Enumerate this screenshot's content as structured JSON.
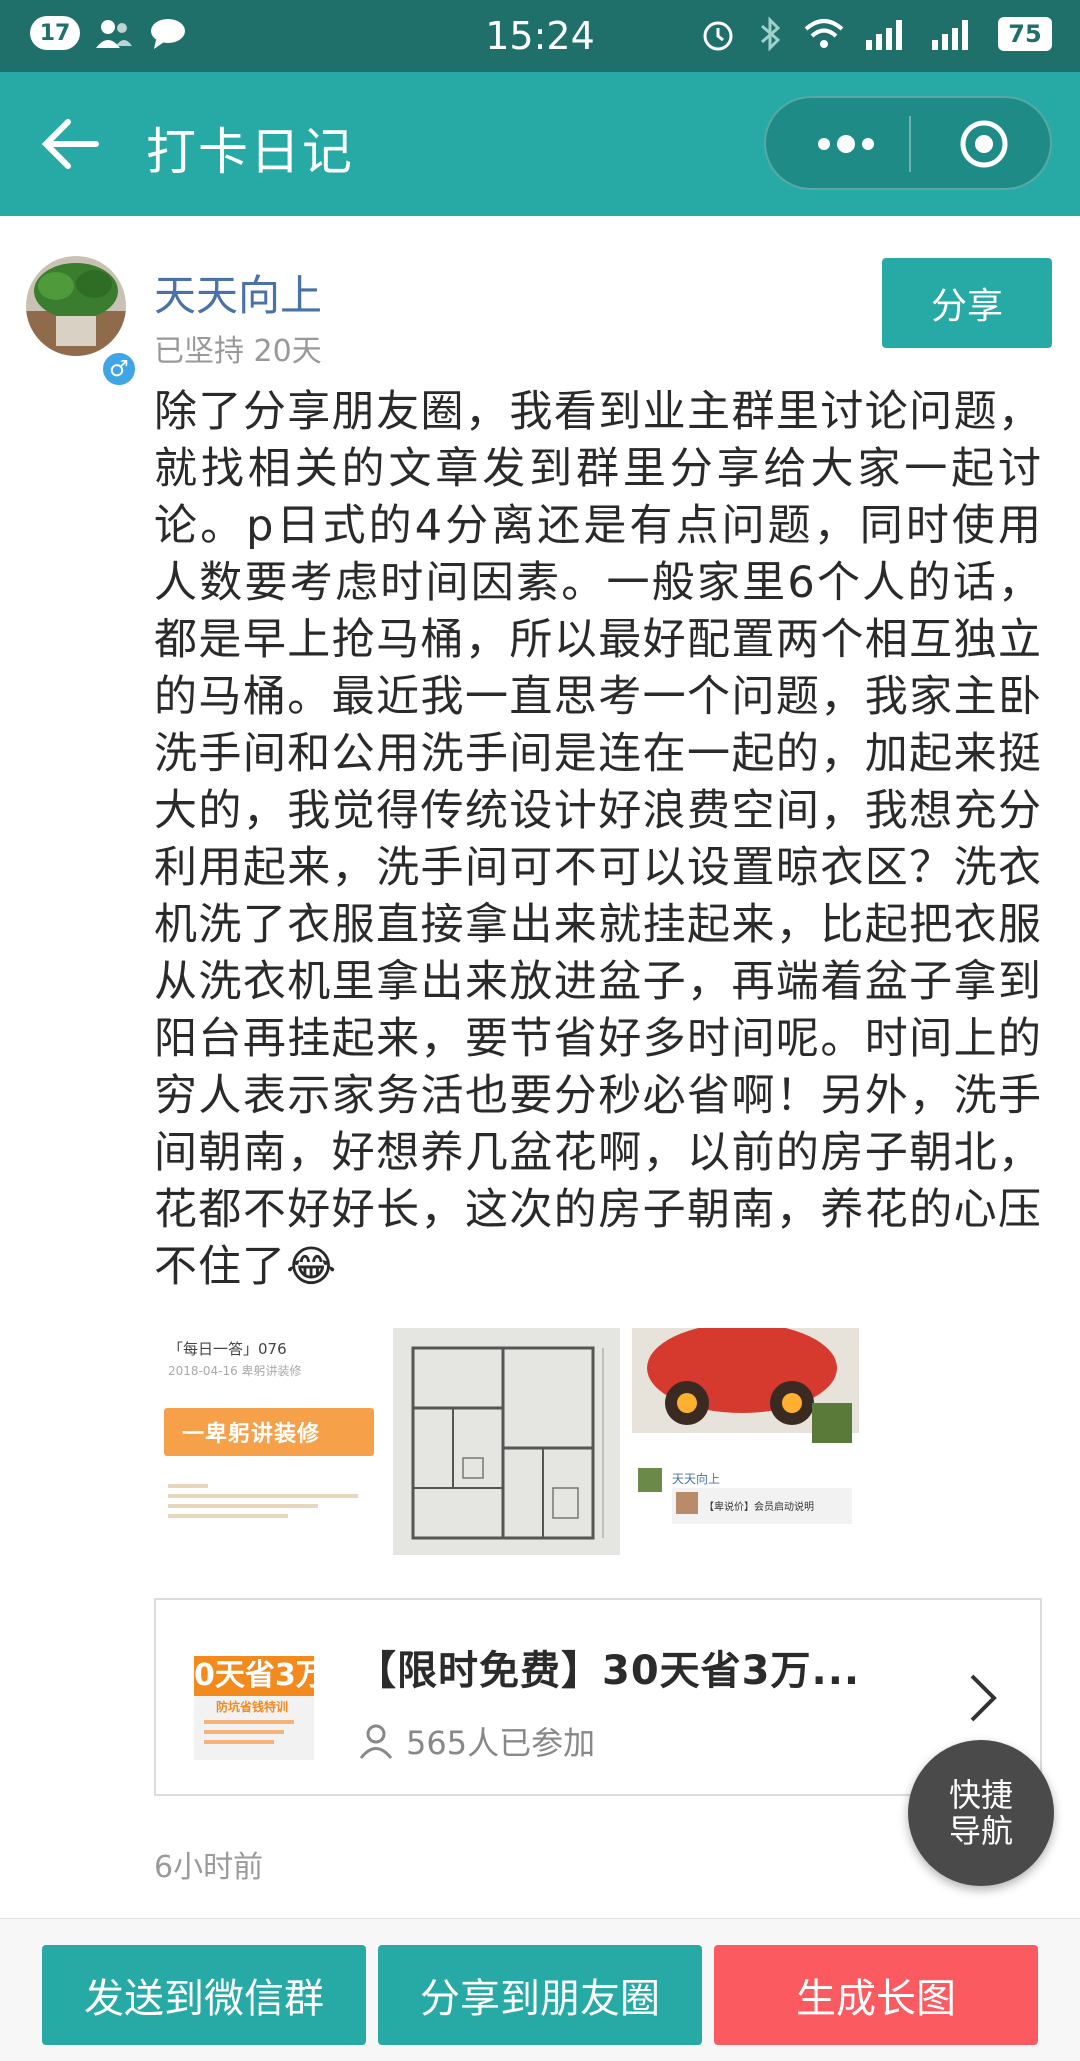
{
  "status_bar": {
    "notification_count": "17",
    "time": "15:24",
    "battery": "75"
  },
  "header": {
    "title": "打卡日记",
    "back_icon": "arrow-left-icon",
    "more_icon": "more-dots-icon",
    "close_icon": "target-circle-icon"
  },
  "post": {
    "username": "天天向上",
    "streak": "已坚持 20天",
    "share_label": "分享",
    "gender_symbol": "♂",
    "text": "除了分享朋友圈，我看到业主群里讨论问题，就找相关的文章发到群里分享给大家一起讨论。p日式的4分离还是有点问题，同时使用人数要考虑时间因素。一般家里6个人的话，都是早上抢马桶，所以最好配置两个相互独立的马桶。最近我一直思考一个问题，我家主卧洗手间和公用洗手间是连在一起的，加起来挺大的，我觉得传统设计好浪费空间，我想充分利用起来，洗手间可不可以设置晾衣区？洗衣机洗了衣服直接拿出来就挂起来，比起把衣服从洗衣机里拿出来放进盆子，再端着盆子拿到阳台再挂起来，要节省好多时间呢。时间上的穷人表示家务活也要分秒必省啊！另外，洗手间朝南，好想养几盆花啊，以前的房子朝北，花都不好好长，这次的房子朝南，养花的心压不住了😂",
    "time_ago": "6小时前",
    "thumbnails": {
      "t1_title": "「每日一答」076",
      "t1_date": "2018-04-16  卑躬讲装修",
      "t1_banner": "一卑躬讲装修",
      "t3_name": "天天向上",
      "t3_msg": "【卑说价】会员启动说明"
    }
  },
  "course": {
    "title": "【限时免费】30天省3万...",
    "participants": "565人已参加",
    "cover_text": "0天省3万",
    "cover_sub": "防坑省钱特训"
  },
  "fab": {
    "line1": "快捷",
    "line2": "导航"
  },
  "bottom_bar": {
    "send_group": "发送到微信群",
    "share_moments": "分享到朋友圈",
    "long_image": "生成长图"
  }
}
